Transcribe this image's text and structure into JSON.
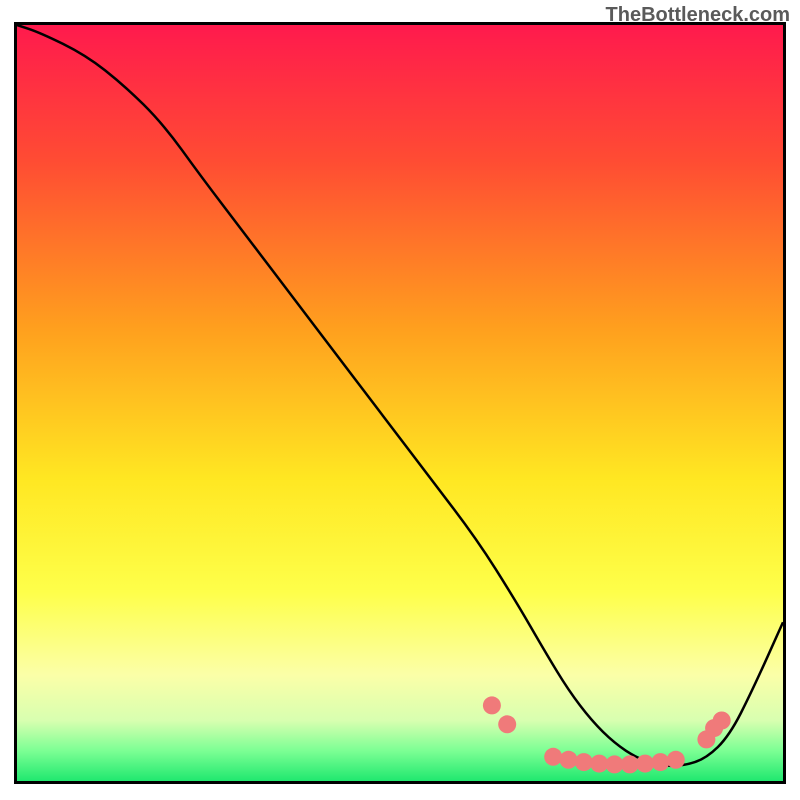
{
  "attribution": "TheBottleneck.com",
  "chart_data": {
    "type": "line",
    "title": "",
    "xlabel": "",
    "ylabel": "",
    "xlim": [
      0,
      100
    ],
    "ylim": [
      0,
      100
    ],
    "background_gradient_stops": [
      {
        "offset": 0,
        "color": "#ff1a4d"
      },
      {
        "offset": 18,
        "color": "#ff4c33"
      },
      {
        "offset": 40,
        "color": "#ff9f1e"
      },
      {
        "offset": 60,
        "color": "#ffe722"
      },
      {
        "offset": 75,
        "color": "#feff4a"
      },
      {
        "offset": 86,
        "color": "#fbffa8"
      },
      {
        "offset": 92,
        "color": "#d8ffb0"
      },
      {
        "offset": 96,
        "color": "#7cff94"
      },
      {
        "offset": 100,
        "color": "#20e86f"
      }
    ],
    "series": [
      {
        "name": "bottleneck-curve",
        "x": [
          0,
          3,
          9,
          14,
          19,
          24,
          30,
          36,
          42,
          48,
          54,
          60,
          65,
          69,
          72,
          75,
          78,
          81,
          84,
          87,
          90,
          93,
          96,
          100
        ],
        "y": [
          100,
          99,
          96,
          92,
          87,
          80,
          72,
          64,
          56,
          48,
          40,
          32,
          24,
          17,
          12,
          8,
          5,
          3,
          2,
          2,
          3,
          6,
          12,
          21
        ]
      }
    ],
    "markers": {
      "name": "highlight-points",
      "color": "#f07a7a",
      "radius": 9,
      "points": [
        {
          "x": 62,
          "y": 10
        },
        {
          "x": 64,
          "y": 7.5
        },
        {
          "x": 70,
          "y": 3.2
        },
        {
          "x": 72,
          "y": 2.8
        },
        {
          "x": 74,
          "y": 2.5
        },
        {
          "x": 76,
          "y": 2.3
        },
        {
          "x": 78,
          "y": 2.2
        },
        {
          "x": 80,
          "y": 2.2
        },
        {
          "x": 82,
          "y": 2.3
        },
        {
          "x": 84,
          "y": 2.5
        },
        {
          "x": 86,
          "y": 2.8
        },
        {
          "x": 90,
          "y": 5.5
        },
        {
          "x": 91,
          "y": 7.0
        },
        {
          "x": 92,
          "y": 8.0
        }
      ]
    }
  }
}
